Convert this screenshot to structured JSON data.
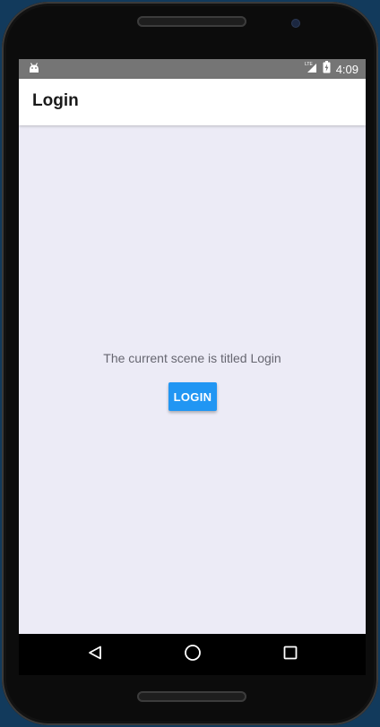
{
  "status_bar": {
    "time": "4:09",
    "network_label": "LTE",
    "icons": [
      "android-icon",
      "lte-signal-icon",
      "battery-charging-icon"
    ]
  },
  "app_bar": {
    "title": "Login"
  },
  "main": {
    "scene_text": "The current scene is titled Login",
    "login_button_label": "LOGIN"
  },
  "nav_bar": {
    "buttons": [
      "back-icon",
      "home-icon",
      "recents-icon"
    ]
  },
  "colors": {
    "accent": "#2196f3",
    "screen_background": "#ecebf6",
    "status_bar": "#757575",
    "app_bar": "#ffffff",
    "nav_bar": "#000000"
  }
}
